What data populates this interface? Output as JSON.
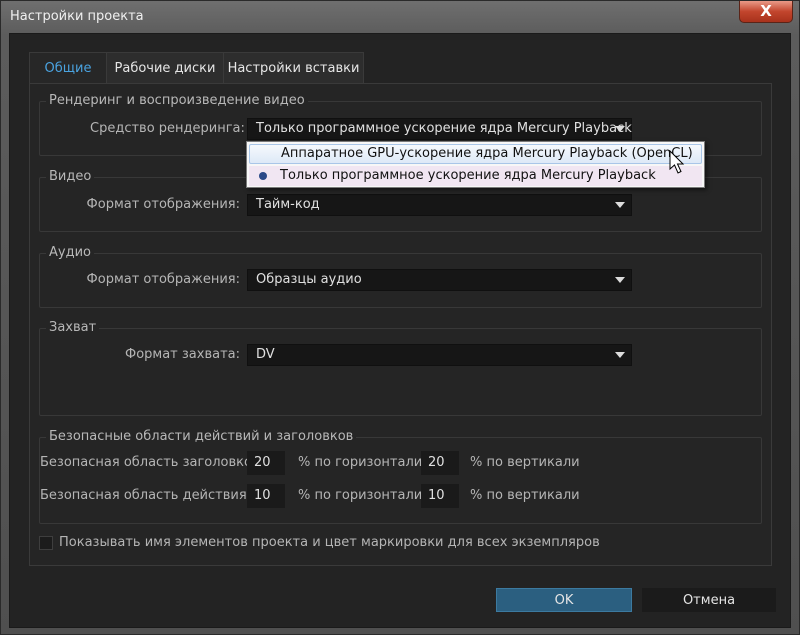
{
  "window": {
    "title": "Настройки проекта",
    "close_glyph": "X"
  },
  "tabs": [
    {
      "label": "Общие",
      "active": true
    },
    {
      "label": "Рабочие диски",
      "active": false
    },
    {
      "label": "Настройки вставки",
      "active": false
    }
  ],
  "render_group": {
    "title": "Рендеринг и воспроизведение видео",
    "renderer_label": "Средство рендеринга:",
    "renderer_value": "Только программное ускорение ядра Mercury Playback",
    "options": [
      "Аппаратное GPU-ускорение ядра Mercury Playback (OpenCL)",
      "Только программное ускорение ядра Mercury Playback"
    ],
    "selected_index": 1,
    "hover_index": 0
  },
  "video_group": {
    "title": "Видео",
    "format_label": "Формат отображения:",
    "format_value": "Тайм-код"
  },
  "audio_group": {
    "title": "Аудио",
    "format_label": "Формат отображения:",
    "format_value": "Образцы аудио"
  },
  "capture_group": {
    "title": "Захват",
    "format_label": "Формат захвата:",
    "format_value": "DV"
  },
  "safe_group": {
    "title": "Безопасные области действий и заголовков",
    "title_area_label": "Безопасная область заголовков",
    "title_area_h": "20",
    "title_area_v": "20",
    "action_area_label": "Безопасная область действия",
    "action_area_h": "10",
    "action_area_v": "10",
    "horizontal_unit": "% по горизонтали",
    "vertical_unit": "% по вертикали"
  },
  "show_names_checkbox": {
    "label": "Показывать имя элементов проекта и цвет маркировки для всех экземпляров",
    "checked": false
  },
  "buttons": {
    "ok": "OK",
    "cancel": "Отмена"
  },
  "colors": {
    "accent_tab": "#4aa3e0",
    "ok_button": "#2b5f80",
    "close_button": "#c2452d"
  }
}
